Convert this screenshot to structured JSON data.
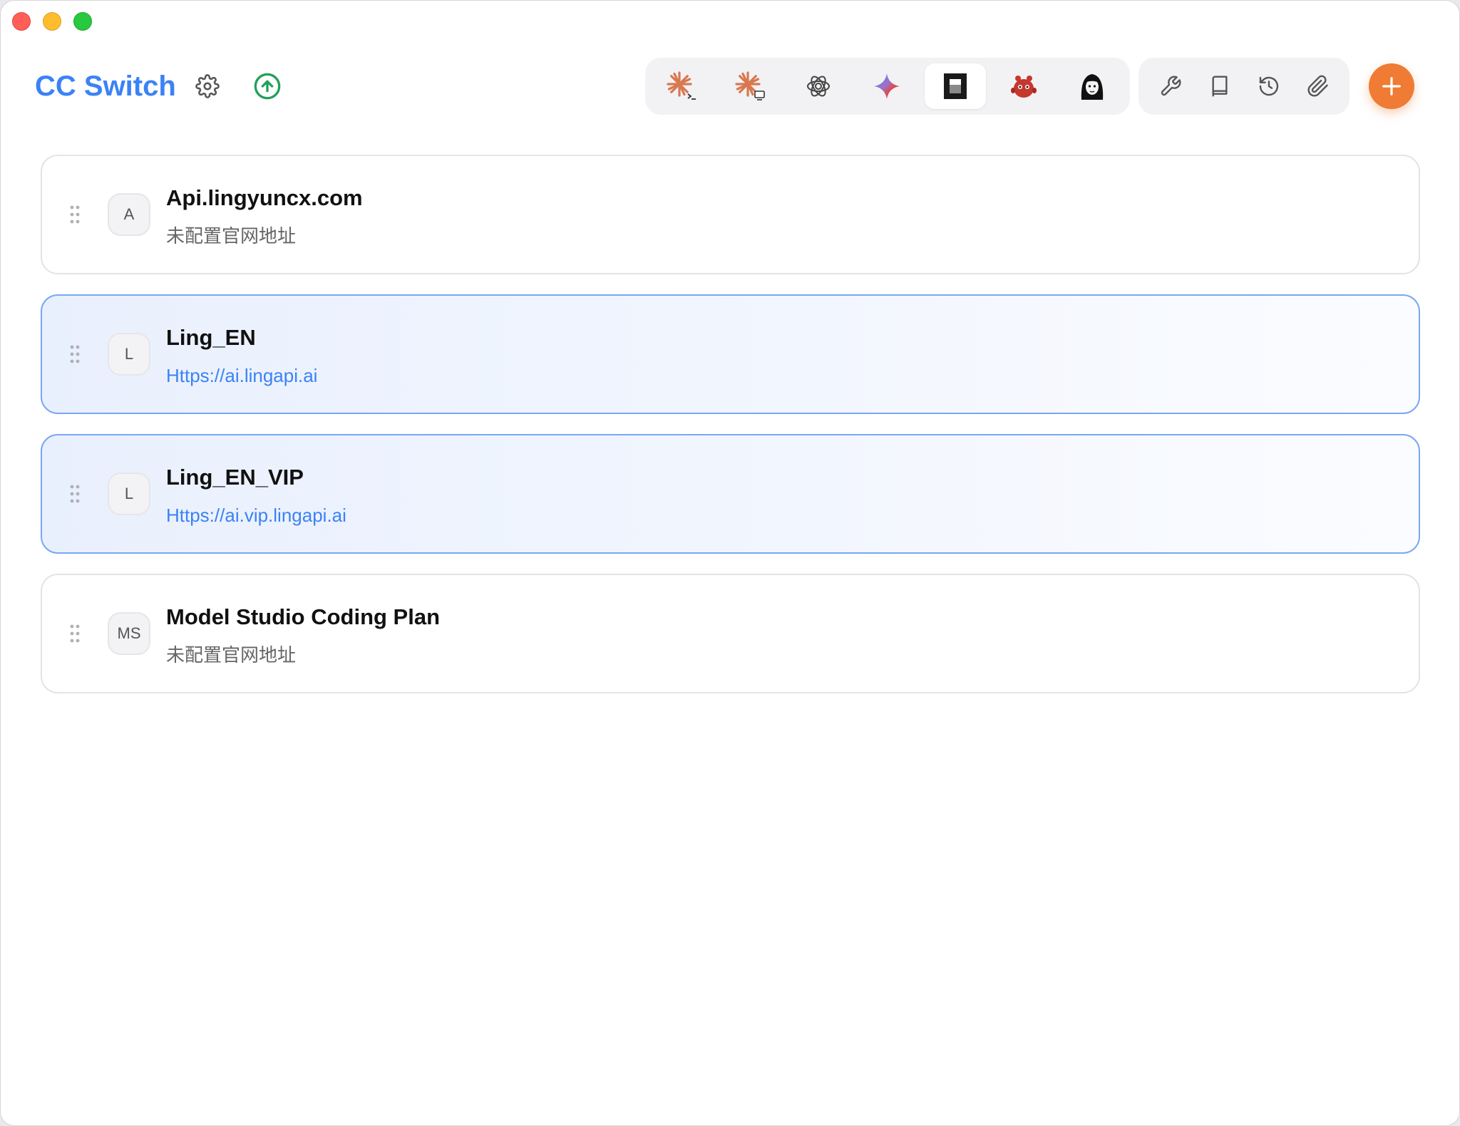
{
  "app": {
    "title": "CC Switch"
  },
  "header": {
    "app_tabs": [
      {
        "name": "claude-code-icon",
        "active": false
      },
      {
        "name": "claude-desktop-icon",
        "active": false
      },
      {
        "name": "openai-codex-icon",
        "active": false
      },
      {
        "name": "gemini-icon",
        "active": false
      },
      {
        "name": "opencode-icon",
        "active": true
      },
      {
        "name": "red-mascot-icon",
        "active": false
      },
      {
        "name": "character-avatar-icon",
        "active": false
      }
    ],
    "tools": [
      "wrench-icon",
      "book-icon",
      "history-icon",
      "paperclip-icon"
    ]
  },
  "colors": {
    "accent": "#3b82f6",
    "add_button": "#ef7b34",
    "active_border": "#7aa7f3"
  },
  "providers": [
    {
      "avatar": "A",
      "name": "Api.lingyuncx.com",
      "url": "未配置官网地址",
      "active": false,
      "link": false
    },
    {
      "avatar": "L",
      "name": "Ling_EN",
      "url": "Https://ai.lingapi.ai",
      "active": true,
      "link": true
    },
    {
      "avatar": "L",
      "name": "Ling_EN_VIP",
      "url": "Https://ai.vip.lingapi.ai",
      "active": true,
      "link": true
    },
    {
      "avatar": "MS",
      "name": "Model Studio Coding Plan",
      "url": "未配置官网地址",
      "active": false,
      "link": false
    }
  ]
}
